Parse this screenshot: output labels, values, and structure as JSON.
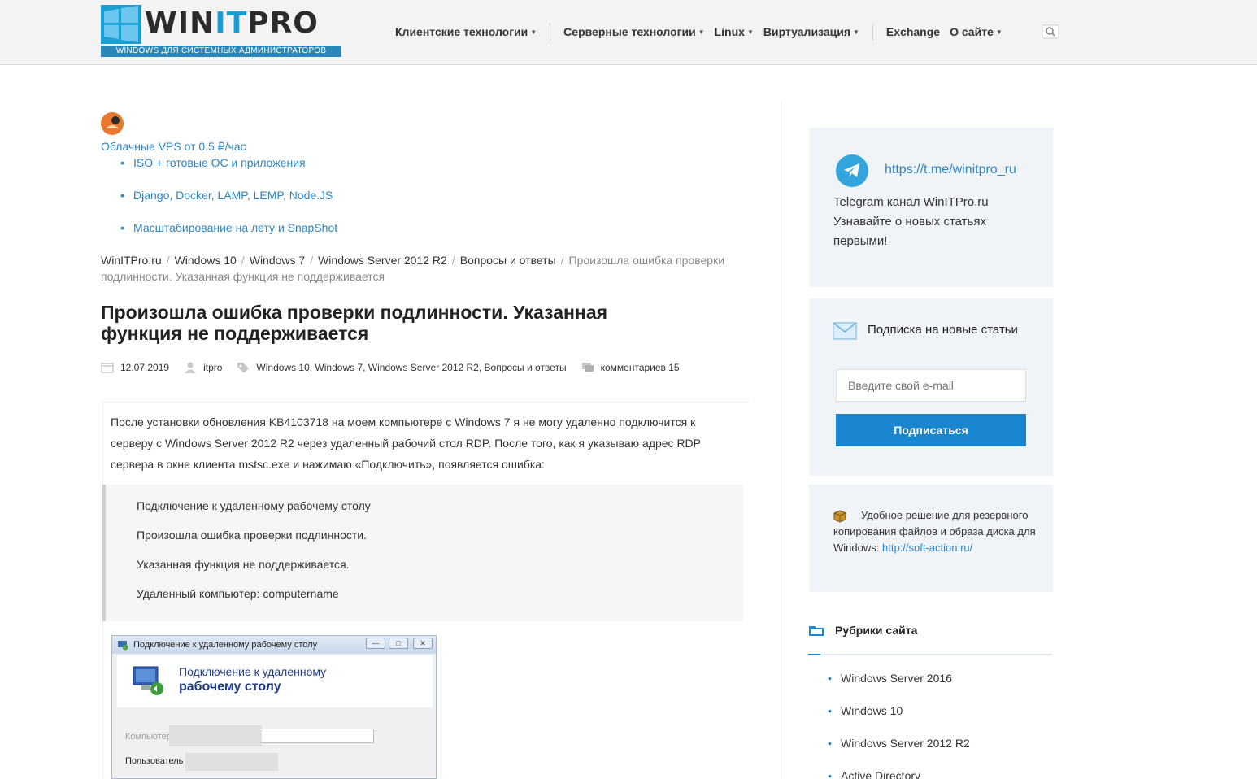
{
  "header": {
    "logo_text_a": "WIN",
    "logo_text_b": "IT",
    "logo_text_c": "PRO",
    "logo_tagline": "WINDOWS ДЛЯ СИСТЕМНЫХ АДМИНИСТРАТОРОВ",
    "nav": [
      {
        "label": "Клиентские технологии",
        "has_caret": true
      },
      {
        "label": "Серверные технологии",
        "has_caret": true
      },
      {
        "label": "Linux",
        "has_caret": true
      },
      {
        "label": "Виртуализация",
        "has_caret": true
      },
      {
        "label": "Exchange",
        "has_caret": false
      },
      {
        "label": "О сайте",
        "has_caret": true
      }
    ],
    "search_icon": "search-icon"
  },
  "ad": {
    "icon": "hosting-logo-icon",
    "link": "Облачные VPS от 0.5 ₽/час",
    "items": [
      "ISO + готовые ОС и приложения",
      "Django, Docker, LAMP, LEMP, Node.JS",
      "Масштабирование на лету и SnapShot"
    ]
  },
  "breadcrumb": {
    "items": [
      "WinITPro.ru",
      "Windows 10",
      "Windows 7",
      "Windows Server 2012 R2",
      "Вопросы и ответы"
    ],
    "current": "Произошла ошибка проверки подлинности. Указанная функция не поддерживается"
  },
  "article": {
    "title": "Произошла ошибка проверки подлинности. Указанная функция не поддерживается",
    "date": "12.07.2019",
    "author": "itpro",
    "categories": "Windows 10, Windows 7, Windows Server 2012 R2, Вопросы и ответы",
    "comments": "комментариев 15",
    "intro": "После установки обновления KB4103718 на моем компьютере с Windows 7 я не могу удаленно подключится к серверу с Windows Server 2012 R2 через удаленный рабочий стол RDP. После того, как я указываю адрес RDP сервера в окне клиента mstsc.exe и нажимаю «Подключить», появляется ошибка:",
    "quote": [
      "Подключение к удаленному рабочему столу",
      "Произошла ошибка проверки подлинности.",
      "Указанная функция не поддерживается.",
      "Удаленный компьютер: computername"
    ],
    "screenshot": {
      "window_title": "Подключение к удаленному рабочему столу",
      "header_line1": "Подключение к удаленному",
      "header_line2": "рабочему столу",
      "row1_label": "Компьютер",
      "row2_label": "Пользователь"
    }
  },
  "sidebar": {
    "telegram": {
      "link": "https://t.me/winitpro_ru",
      "text": "Telegram канал WinITPro.ru Узнавайте о новых статьях первыми!"
    },
    "subscribe": {
      "title": "Подписка на новые статьи",
      "placeholder": "Введите свой e-mail",
      "button": "Подписаться"
    },
    "backup": {
      "text": "Удобное решение для резервного копирования файлов и образа диска для Windows:",
      "link": "http://soft-action.ru/"
    },
    "rubrics": {
      "title": "Рубрики сайта",
      "items": [
        "Windows Server 2016",
        "Windows 10",
        "Windows Server 2012 R2",
        "Active Directory"
      ]
    }
  },
  "colors": {
    "accent": "#1a86cf",
    "link": "#2a86c8",
    "telegram": "#34a4dd"
  }
}
